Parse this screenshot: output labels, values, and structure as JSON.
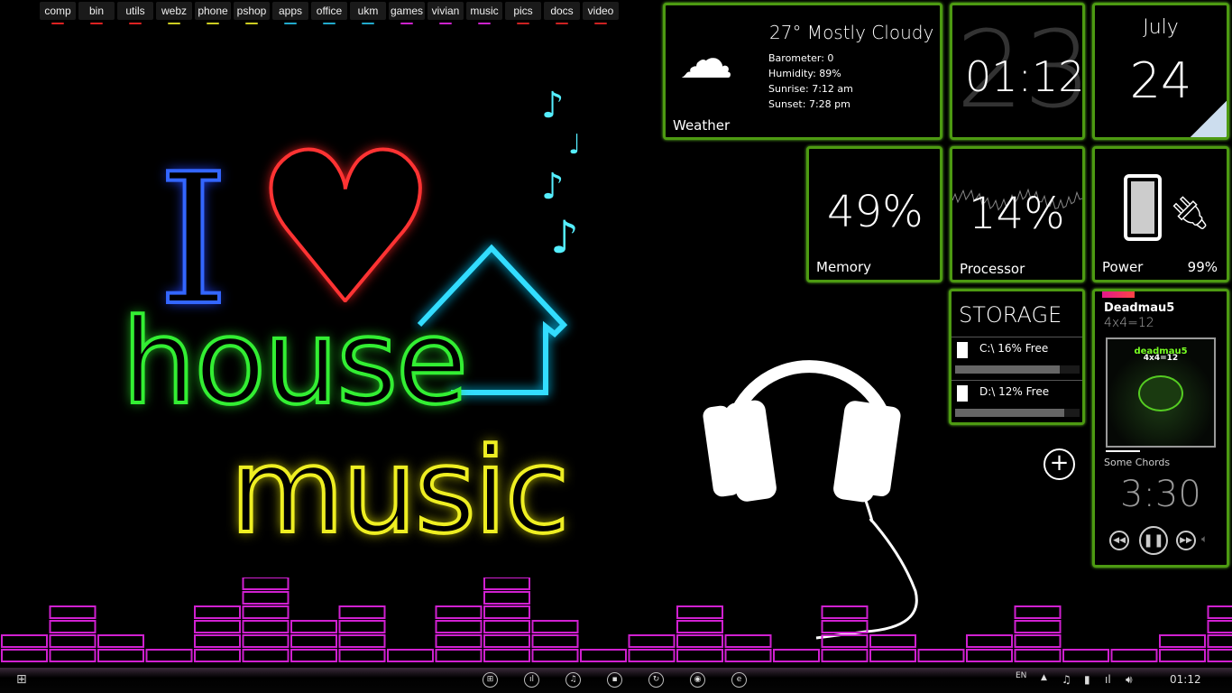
{
  "launcher": [
    {
      "label": "comp",
      "color": "#d22"
    },
    {
      "label": "bin",
      "color": "#d22"
    },
    {
      "label": "utils",
      "color": "#d22"
    },
    {
      "label": "webz",
      "color": "#cc2"
    },
    {
      "label": "phone",
      "color": "#cc2"
    },
    {
      "label": "pshop",
      "color": "#cc2"
    },
    {
      "label": "apps",
      "color": "#2ac"
    },
    {
      "label": "office",
      "color": "#2ac"
    },
    {
      "label": "ukm",
      "color": "#2ac"
    },
    {
      "label": "games",
      "color": "#c2c"
    },
    {
      "label": "vivian",
      "color": "#c2c"
    },
    {
      "label": "music",
      "color": "#c2c"
    },
    {
      "label": "pics",
      "color": "#c22"
    },
    {
      "label": "docs",
      "color": "#c22"
    },
    {
      "label": "video",
      "color": "#c22"
    }
  ],
  "wallpaper": {
    "line1": "I",
    "heart": "♥",
    "line2": "house",
    "line3": "music"
  },
  "weather": {
    "title": "Weather",
    "condition": "27° Mostly Cloudy",
    "barometer": "Barometer: 0",
    "humidity": "Humidity: 89%",
    "sunrise": "Sunrise: 7:12 am",
    "sunset": "Sunset: 7:28 pm",
    "icon": "cloud-moon-icon"
  },
  "clock": {
    "time": "01:12",
    "bg_digits": "23"
  },
  "date": {
    "month": "July",
    "day": "24"
  },
  "memory": {
    "value": "49%",
    "label": "Memory"
  },
  "processor": {
    "value": "14%",
    "label": "Processor"
  },
  "power": {
    "label": "Power",
    "value": "99%",
    "icon": "battery-icon"
  },
  "storage": {
    "title": "STORAGE",
    "drives": [
      {
        "label": "C:\\ 16% Free",
        "used": 0.84
      },
      {
        "label": "D:\\ 12% Free",
        "used": 0.88
      }
    ]
  },
  "music": {
    "artist": "Deadmau5",
    "album": "4x4=12",
    "cover_title": "deadmau5",
    "cover_sub": "4x4=12",
    "track": "Some Chords",
    "time": "3:30",
    "progress": 0.3
  },
  "taskbar": {
    "lang": "EN",
    "time": "01:12"
  },
  "colors": {
    "tile_border": "#4d9a12",
    "eq": "#d020d0"
  }
}
